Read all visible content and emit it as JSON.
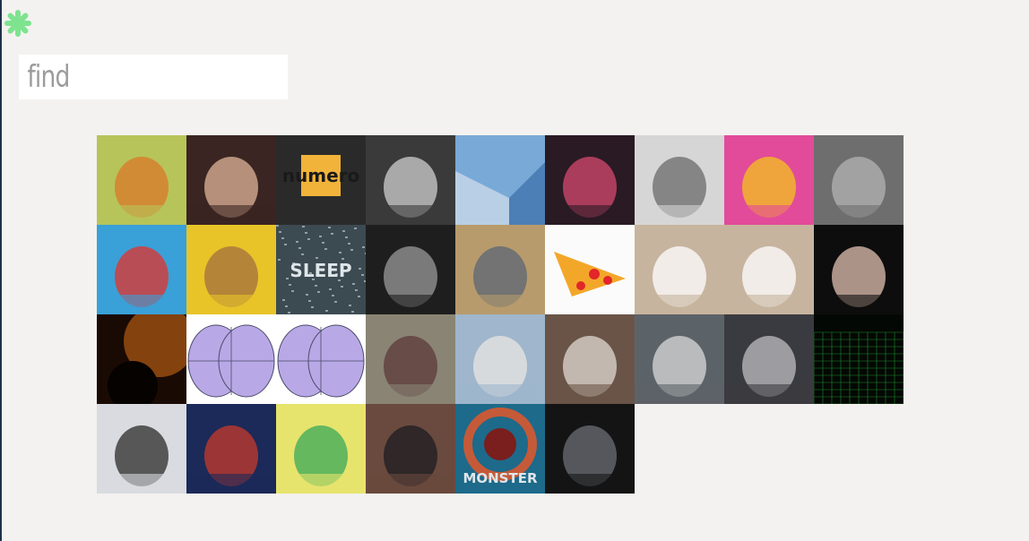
{
  "app": {
    "logo_icon": "asterisk-icon",
    "logo_color": "#7ee38f"
  },
  "search": {
    "placeholder": "find",
    "value": ""
  },
  "colors": {
    "background": "#f3f2f0",
    "input_background": "#ffffff",
    "placeholder_text": "#9b9b9b"
  },
  "gallery": {
    "tiles": [
      {
        "subject": "tiger-cartoon",
        "bg": "#b7c45a",
        "fg": "#d9782a",
        "text": ""
      },
      {
        "subject": "painted-nails",
        "bg": "#3a2522",
        "fg": "#e0b49a",
        "text": ""
      },
      {
        "subject": "numero-box",
        "bg": "#2a2a2a",
        "fg": "#f2b33a",
        "text": "numero"
      },
      {
        "subject": "bw-hands",
        "bg": "#3a3a3a",
        "fg": "#cfcfcf",
        "text": ""
      },
      {
        "subject": "mario-ice-level",
        "bg": "#79a9d6",
        "fg": "#b9cfe6",
        "text": ""
      },
      {
        "subject": "neon-street",
        "bg": "#2a1a24",
        "fg": "#d64a6e",
        "text": ""
      },
      {
        "subject": "glitch-face",
        "bg": "#d6d6d6",
        "fg": "#6a6a6a",
        "text": ""
      },
      {
        "subject": "pizza-collage",
        "bg": "#e24b9a",
        "fg": "#f3c21c",
        "text": ""
      },
      {
        "subject": "bw-woman-drinking",
        "bg": "#6e6e6e",
        "fg": "#b4b4b4",
        "text": ""
      },
      {
        "subject": "cartoon-couple",
        "bg": "#3aa0d8",
        "fg": "#e4312a",
        "text": ""
      },
      {
        "subject": "man-on-yellow",
        "bg": "#e8c428",
        "fg": "#a3703f",
        "text": ""
      },
      {
        "subject": "sleep-static",
        "bg": "#3c4a52",
        "fg": "#cfd8dc",
        "text": "SLEEP"
      },
      {
        "subject": "bw-kiss",
        "bg": "#1e1e1e",
        "fg": "#9a9a9a",
        "text": ""
      },
      {
        "subject": "hamster",
        "bg": "#b89b6c",
        "fg": "#5b6574",
        "text": ""
      },
      {
        "subject": "cat-pizza",
        "bg": "#fbfbfb",
        "fg": "#f3a729",
        "text": ""
      },
      {
        "subject": "dancing-man",
        "bg": "#c7b49f",
        "fg": "#ffffff",
        "text": ""
      },
      {
        "subject": "dancing-man-2",
        "bg": "#c7b49f",
        "fg": "#ffffff",
        "text": ""
      },
      {
        "subject": "dancers-dark",
        "bg": "#0d0d0d",
        "fg": "#e2c0b0",
        "text": ""
      },
      {
        "subject": "dark-planet",
        "bg": "#1a0a04",
        "fg": "#b25a12",
        "text": ""
      },
      {
        "subject": "purple-sphere",
        "bg": "#ffffff",
        "fg": "#b9a8e6",
        "text": ""
      },
      {
        "subject": "purple-sphere-2",
        "bg": "#ffffff",
        "fg": "#b9a8e6",
        "text": ""
      },
      {
        "subject": "street-scene",
        "bg": "#8a8474",
        "fg": "#5c3a3a",
        "text": ""
      },
      {
        "subject": "beach-dancer",
        "bg": "#9fb6cc",
        "fg": "#e9e6e2",
        "text": ""
      },
      {
        "subject": "puppy",
        "bg": "#6a5448",
        "fg": "#e2dad2",
        "text": ""
      },
      {
        "subject": "laptop-hands",
        "bg": "#5c6368",
        "fg": "#d8d8d8",
        "text": ""
      },
      {
        "subject": "bw-cat",
        "bg": "#3a3b40",
        "fg": "#bdbdc2",
        "text": ""
      },
      {
        "subject": "green-grid",
        "bg": "#040804",
        "fg": "#1f8a2f",
        "text": ""
      },
      {
        "subject": "ice-rink-dog",
        "bg": "#d9dbe0",
        "fg": "#2b2b2b",
        "text": ""
      },
      {
        "subject": "redhead-collage",
        "bg": "#1b2a58",
        "fg": "#c83a2a",
        "text": ""
      },
      {
        "subject": "cartoon-city-ad",
        "bg": "#e7e46e",
        "fg": "#3aa95a",
        "text": ""
      },
      {
        "subject": "crowd-man",
        "bg": "#6a4a3e",
        "fg": "#1c1c22",
        "text": ""
      },
      {
        "subject": "monster-poster",
        "bg": "#1d6a8a",
        "fg": "#c55a38",
        "text": "MONSTER"
      },
      {
        "subject": "dark-window",
        "bg": "#141414",
        "fg": "#6b6e74",
        "text": ""
      }
    ]
  }
}
